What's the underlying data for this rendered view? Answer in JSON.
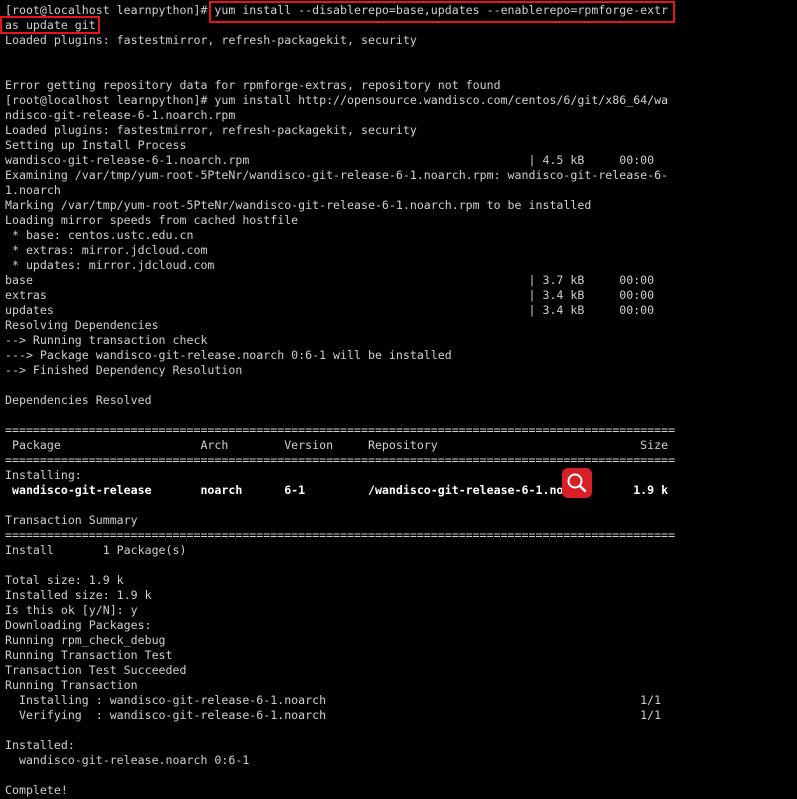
{
  "terminal": {
    "lines": [
      "[root@localhost learnpython]# yum install --disablerepo=base,updates --enablerepo=rpmforge-extr",
      "as update git",
      "Loaded plugins: fastestmirror, refresh-packagekit, security",
      "",
      "",
      "Error getting repository data for rpmforge-extras, repository not found",
      "[root@localhost learnpython]# yum install http://opensource.wandisco.com/centos/6/git/x86_64/wa",
      "ndisco-git-release-6-1.noarch.rpm",
      "Loaded plugins: fastestmirror, refresh-packagekit, security",
      "Setting up Install Process",
      "wandisco-git-release-6-1.noarch.rpm                                        | 4.5 kB     00:00",
      "Examining /var/tmp/yum-root-5PteNr/wandisco-git-release-6-1.noarch.rpm: wandisco-git-release-6-",
      "1.noarch",
      "Marking /var/tmp/yum-root-5PteNr/wandisco-git-release-6-1.noarch.rpm to be installed",
      "Loading mirror speeds from cached hostfile",
      " * base: centos.ustc.edu.cn",
      " * extras: mirror.jdcloud.com",
      " * updates: mirror.jdcloud.com",
      "base                                                                       | 3.7 kB     00:00",
      "extras                                                                     | 3.4 kB     00:00",
      "updates                                                                    | 3.4 kB     00:00",
      "Resolving Dependencies",
      "--> Running transaction check",
      "---> Package wandisco-git-release.noarch 0:6-1 will be installed",
      "--> Finished Dependency Resolution",
      "",
      "Dependencies Resolved",
      "",
      "================================================================================================",
      " Package                    Arch        Version     Repository                             Size",
      "================================================================================================",
      "Installing:",
      " wandisco-git-release       noarch      6-1         /wandisco-git-release-6-1.noarch      1.9 k",
      "",
      "Transaction Summary",
      "================================================================================================",
      "Install       1 Package(s)",
      "",
      "Total size: 1.9 k",
      "Installed size: 1.9 k",
      "Is this ok [y/N]: y",
      "Downloading Packages:",
      "Running rpm_check_debug",
      "Running Transaction Test",
      "Transaction Test Succeeded",
      "Running Transaction",
      "  Installing : wandisco-git-release-6-1.noarch                                             1/1",
      "  Verifying  : wandisco-git-release-6-1.noarch                                             1/1",
      "",
      "Installed:",
      "  wandisco-git-release.noarch 0:6-1",
      "",
      "Complete!"
    ]
  },
  "colors": {
    "background": "#000000",
    "text": "#cfcfcf",
    "highlight": "#e8141c",
    "search_button": "#d61f26"
  },
  "icons": {
    "search_button": "search-icon"
  }
}
